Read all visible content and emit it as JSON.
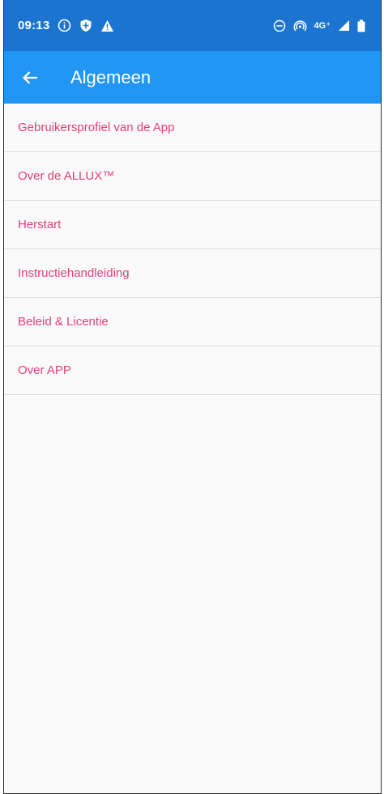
{
  "status_bar": {
    "time": "09:13",
    "network": "4G⁺",
    "left_icons": [
      "info-icon",
      "shield-icon",
      "warning-icon"
    ],
    "right_icons": [
      "do-not-disturb-icon",
      "hotspot-icon",
      "signal-icon",
      "battery-icon"
    ]
  },
  "app_bar": {
    "title": "Algemeen",
    "back_icon": "arrow-back-icon"
  },
  "menu": {
    "items": [
      {
        "label": "Gebruikersprofiel van de App"
      },
      {
        "label": "Over de ALLUX™"
      },
      {
        "label": "Herstart"
      },
      {
        "label": "Instructiehandleiding"
      },
      {
        "label": "Beleid & Licentie"
      },
      {
        "label": "Over APP"
      }
    ]
  },
  "colors": {
    "status_bar": "#1b74cf",
    "app_bar": "#2196f3",
    "menu_text": "#e73c7e",
    "background": "#fafafa",
    "divider": "#dcdcdc"
  }
}
